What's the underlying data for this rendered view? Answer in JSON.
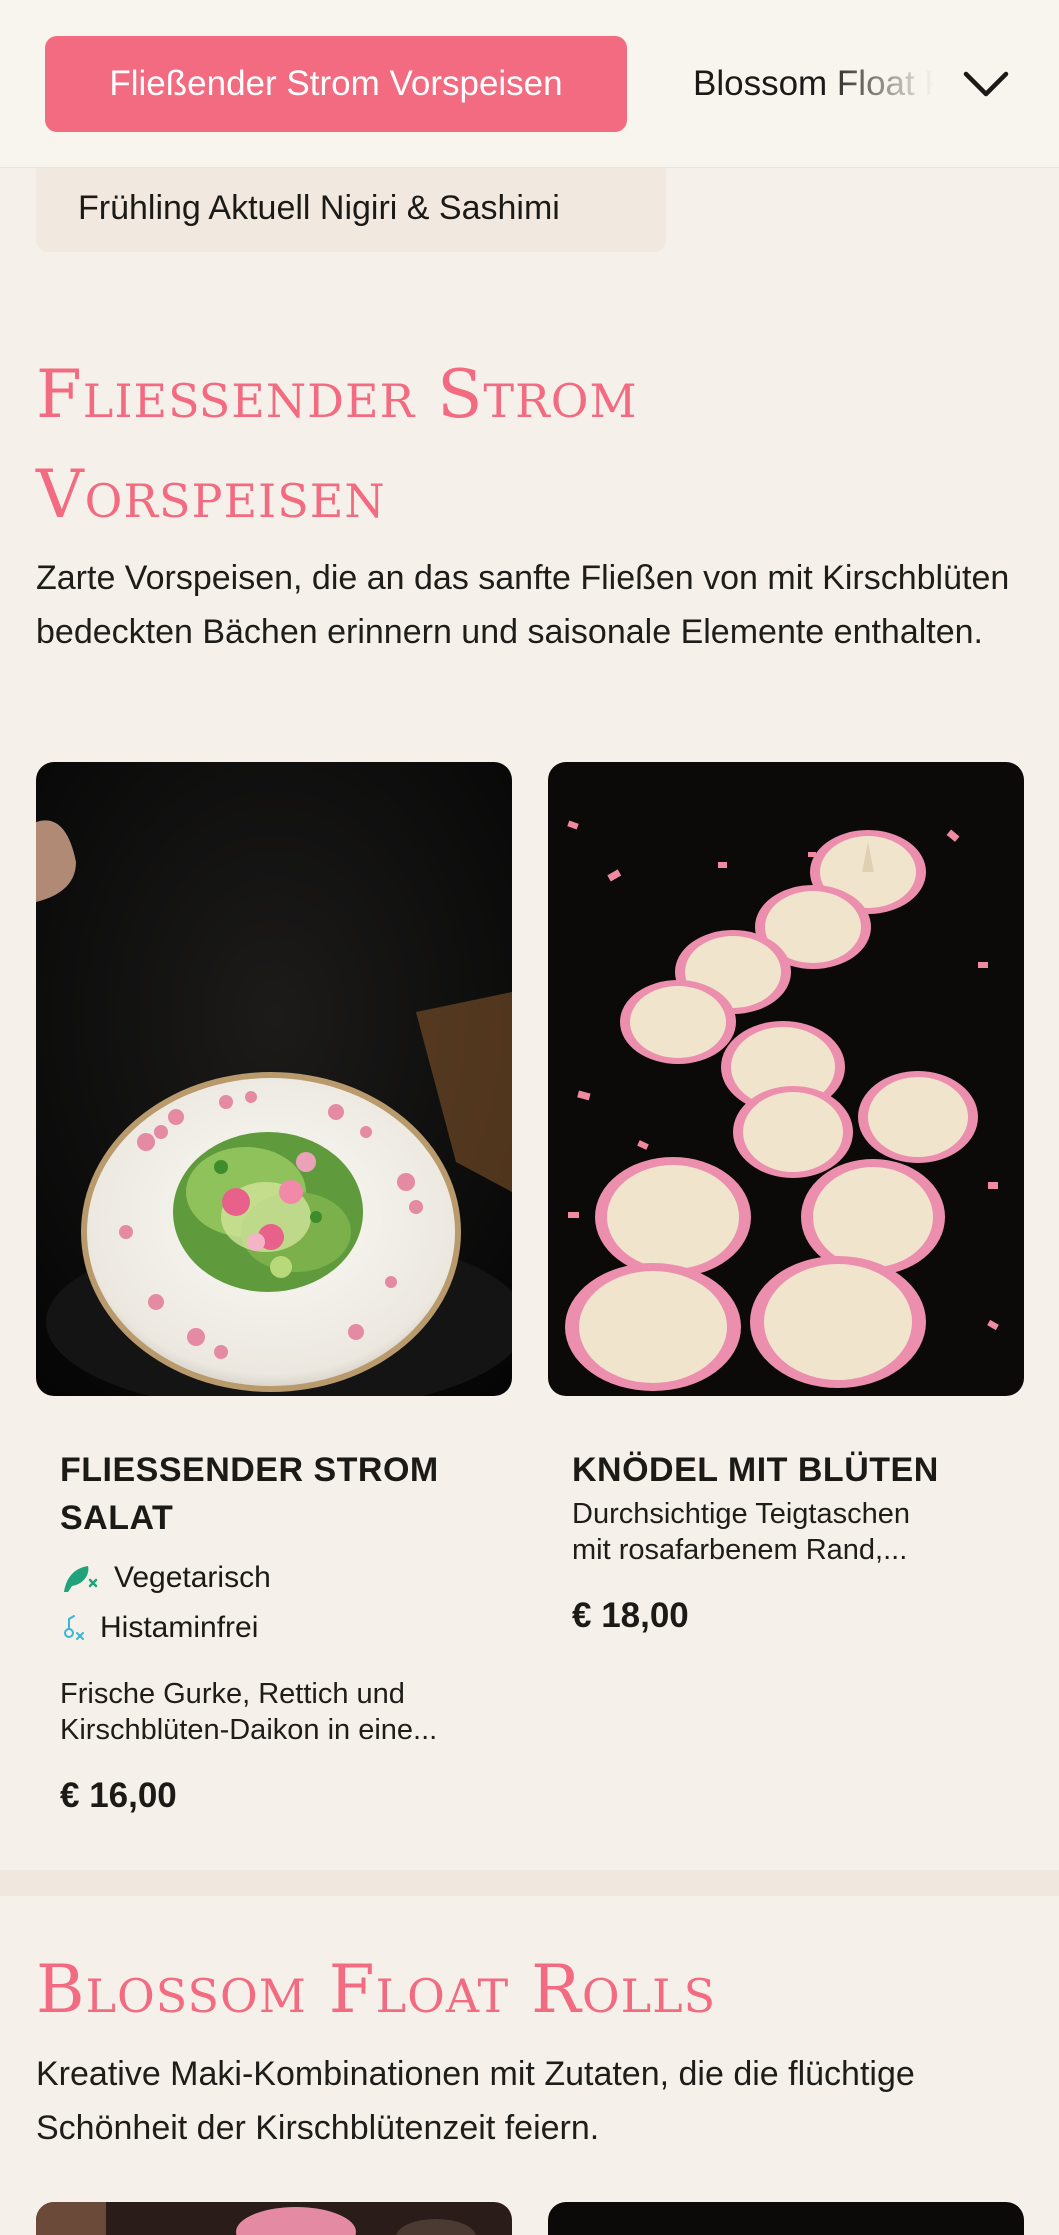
{
  "nav": {
    "active_tab": "Fließender Strom Vorspeisen",
    "next_tab": "Blossom Float Rolls",
    "dropdown_item": "Frühling Aktuell Nigiri & Sashimi"
  },
  "sections": [
    {
      "title_line1": "Fließender Strom",
      "title_line2": "Vorspeisen",
      "description": "Zarte Vorspeisen, die an das sanfte Fließen von mit Kirschblüten bedeckten Bächen erinnern und saisonale Elemente enthalten.",
      "items": [
        {
          "name": "Fließender Strom Salat",
          "badges": [
            "Vegetarisch",
            "Histaminfrei"
          ],
          "description_line1": "Frische Gurke, Rettich und",
          "description_line2": "Kirschblüten-Daikon in eine...",
          "price": "€ 16,00"
        },
        {
          "name": "Knödel mit Blüten",
          "description_line1": "Durchsichtige Teigtaschen",
          "description_line2": "mit rosafarbenem Rand,...",
          "price": "€ 18,00"
        }
      ]
    },
    {
      "title": "Blossom Float Rolls",
      "description": "Kreative Maki-Kombinationen mit Zutaten, die die flüchtige Schönheit der Kirschblütenzeit feiern."
    }
  ],
  "colors": {
    "accent": "#f26b80",
    "background": "#f5f0e9",
    "vegetarian_badge": "#1fa37a",
    "histamine_badge": "#38b6d9"
  },
  "icons": {
    "dropdown": "chevron-down-icon",
    "vegetarian": "leaf-icon",
    "histamine": "histamine-free-icon"
  }
}
